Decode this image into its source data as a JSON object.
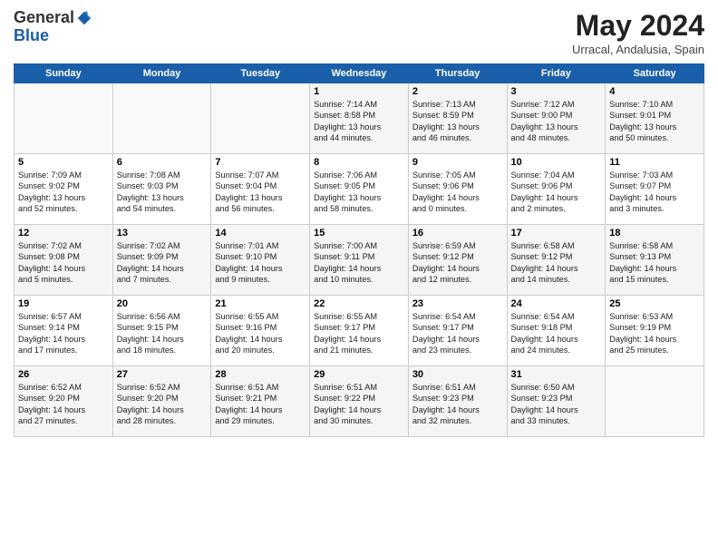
{
  "header": {
    "logo_line1": "General",
    "logo_line2": "Blue",
    "month": "May 2024",
    "location": "Urracal, Andalusia, Spain"
  },
  "weekdays": [
    "Sunday",
    "Monday",
    "Tuesday",
    "Wednesday",
    "Thursday",
    "Friday",
    "Saturday"
  ],
  "weeks": [
    [
      {
        "day": "",
        "info": ""
      },
      {
        "day": "",
        "info": ""
      },
      {
        "day": "",
        "info": ""
      },
      {
        "day": "1",
        "info": "Sunrise: 7:14 AM\nSunset: 8:58 PM\nDaylight: 13 hours\nand 44 minutes."
      },
      {
        "day": "2",
        "info": "Sunrise: 7:13 AM\nSunset: 8:59 PM\nDaylight: 13 hours\nand 46 minutes."
      },
      {
        "day": "3",
        "info": "Sunrise: 7:12 AM\nSunset: 9:00 PM\nDaylight: 13 hours\nand 48 minutes."
      },
      {
        "day": "4",
        "info": "Sunrise: 7:10 AM\nSunset: 9:01 PM\nDaylight: 13 hours\nand 50 minutes."
      }
    ],
    [
      {
        "day": "5",
        "info": "Sunrise: 7:09 AM\nSunset: 9:02 PM\nDaylight: 13 hours\nand 52 minutes."
      },
      {
        "day": "6",
        "info": "Sunrise: 7:08 AM\nSunset: 9:03 PM\nDaylight: 13 hours\nand 54 minutes."
      },
      {
        "day": "7",
        "info": "Sunrise: 7:07 AM\nSunset: 9:04 PM\nDaylight: 13 hours\nand 56 minutes."
      },
      {
        "day": "8",
        "info": "Sunrise: 7:06 AM\nSunset: 9:05 PM\nDaylight: 13 hours\nand 58 minutes."
      },
      {
        "day": "9",
        "info": "Sunrise: 7:05 AM\nSunset: 9:06 PM\nDaylight: 14 hours\nand 0 minutes."
      },
      {
        "day": "10",
        "info": "Sunrise: 7:04 AM\nSunset: 9:06 PM\nDaylight: 14 hours\nand 2 minutes."
      },
      {
        "day": "11",
        "info": "Sunrise: 7:03 AM\nSunset: 9:07 PM\nDaylight: 14 hours\nand 3 minutes."
      }
    ],
    [
      {
        "day": "12",
        "info": "Sunrise: 7:02 AM\nSunset: 9:08 PM\nDaylight: 14 hours\nand 5 minutes."
      },
      {
        "day": "13",
        "info": "Sunrise: 7:02 AM\nSunset: 9:09 PM\nDaylight: 14 hours\nand 7 minutes."
      },
      {
        "day": "14",
        "info": "Sunrise: 7:01 AM\nSunset: 9:10 PM\nDaylight: 14 hours\nand 9 minutes."
      },
      {
        "day": "15",
        "info": "Sunrise: 7:00 AM\nSunset: 9:11 PM\nDaylight: 14 hours\nand 10 minutes."
      },
      {
        "day": "16",
        "info": "Sunrise: 6:59 AM\nSunset: 9:12 PM\nDaylight: 14 hours\nand 12 minutes."
      },
      {
        "day": "17",
        "info": "Sunrise: 6:58 AM\nSunset: 9:12 PM\nDaylight: 14 hours\nand 14 minutes."
      },
      {
        "day": "18",
        "info": "Sunrise: 6:58 AM\nSunset: 9:13 PM\nDaylight: 14 hours\nand 15 minutes."
      }
    ],
    [
      {
        "day": "19",
        "info": "Sunrise: 6:57 AM\nSunset: 9:14 PM\nDaylight: 14 hours\nand 17 minutes."
      },
      {
        "day": "20",
        "info": "Sunrise: 6:56 AM\nSunset: 9:15 PM\nDaylight: 14 hours\nand 18 minutes."
      },
      {
        "day": "21",
        "info": "Sunrise: 6:55 AM\nSunset: 9:16 PM\nDaylight: 14 hours\nand 20 minutes."
      },
      {
        "day": "22",
        "info": "Sunrise: 6:55 AM\nSunset: 9:17 PM\nDaylight: 14 hours\nand 21 minutes."
      },
      {
        "day": "23",
        "info": "Sunrise: 6:54 AM\nSunset: 9:17 PM\nDaylight: 14 hours\nand 23 minutes."
      },
      {
        "day": "24",
        "info": "Sunrise: 6:54 AM\nSunset: 9:18 PM\nDaylight: 14 hours\nand 24 minutes."
      },
      {
        "day": "25",
        "info": "Sunrise: 6:53 AM\nSunset: 9:19 PM\nDaylight: 14 hours\nand 25 minutes."
      }
    ],
    [
      {
        "day": "26",
        "info": "Sunrise: 6:52 AM\nSunset: 9:20 PM\nDaylight: 14 hours\nand 27 minutes."
      },
      {
        "day": "27",
        "info": "Sunrise: 6:52 AM\nSunset: 9:20 PM\nDaylight: 14 hours\nand 28 minutes."
      },
      {
        "day": "28",
        "info": "Sunrise: 6:51 AM\nSunset: 9:21 PM\nDaylight: 14 hours\nand 29 minutes."
      },
      {
        "day": "29",
        "info": "Sunrise: 6:51 AM\nSunset: 9:22 PM\nDaylight: 14 hours\nand 30 minutes."
      },
      {
        "day": "30",
        "info": "Sunrise: 6:51 AM\nSunset: 9:23 PM\nDaylight: 14 hours\nand 32 minutes."
      },
      {
        "day": "31",
        "info": "Sunrise: 6:50 AM\nSunset: 9:23 PM\nDaylight: 14 hours\nand 33 minutes."
      },
      {
        "day": "",
        "info": ""
      }
    ]
  ]
}
